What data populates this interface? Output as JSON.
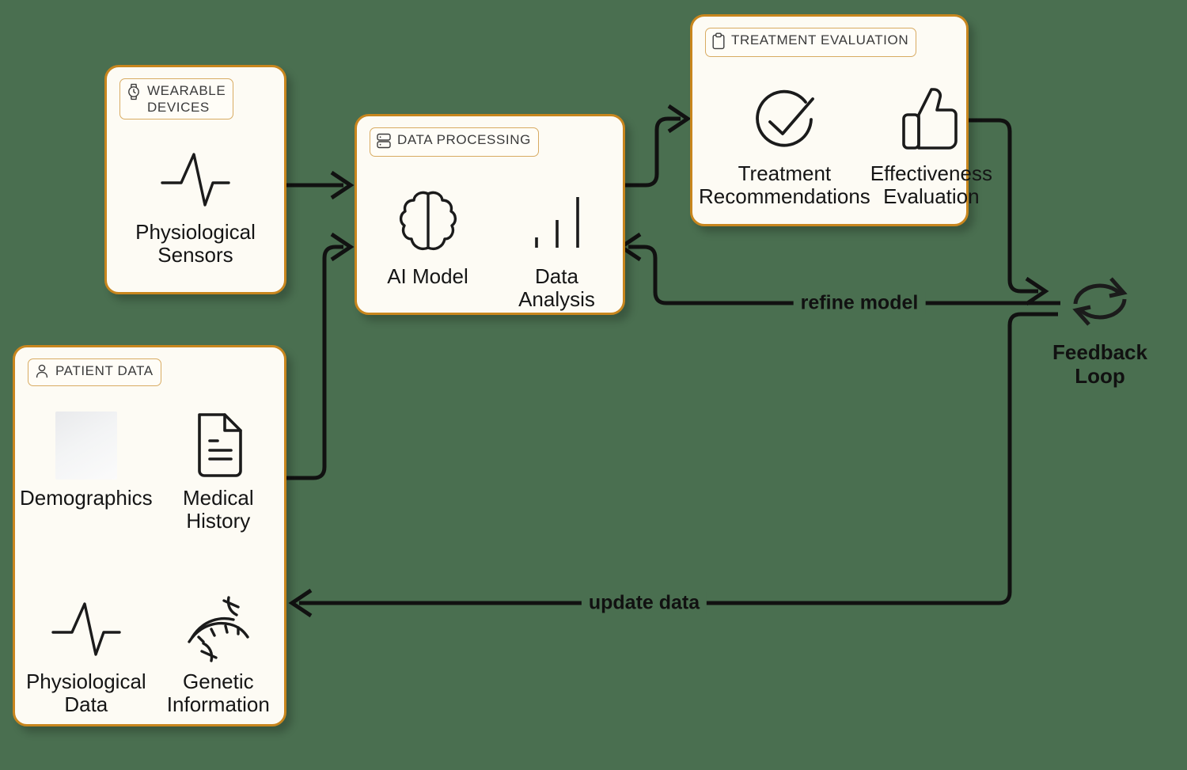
{
  "theme": {
    "background": "#4a6f50",
    "node_fill": "#fdfbf4",
    "node_border": "#c8861e",
    "badge_border": "#d8ab62",
    "stroke": "#111111"
  },
  "nodes": [
    {
      "id": "wearable-devices",
      "badge_label": "WEARABLE\nDEVICES",
      "badge_icon": "watch-icon",
      "items": [
        {
          "label": "Physiological\nSensors",
          "icon": "pulse-wave-icon"
        }
      ]
    },
    {
      "id": "patient-data",
      "badge_label": "PATIENT DATA",
      "badge_icon": "person-icon",
      "items": [
        {
          "label": "Demographics",
          "icon": "image-placeholder-icon"
        },
        {
          "label": "Medical\nHistory",
          "icon": "document-icon"
        },
        {
          "label": "Physiological\nData",
          "icon": "pulse-wave-icon"
        },
        {
          "label": "Genetic\nInformation",
          "icon": "dna-icon"
        }
      ]
    },
    {
      "id": "data-processing",
      "badge_label": "DATA PROCESSING",
      "badge_icon": "server-icon",
      "items": [
        {
          "label": "AI Model",
          "icon": "brain-icon"
        },
        {
          "label": "Data\nAnalysis",
          "icon": "bar-chart-icon"
        }
      ]
    },
    {
      "id": "treatment-evaluation",
      "badge_label": "TREATMENT EVALUATION",
      "badge_icon": "clipboard-icon",
      "items": [
        {
          "label": "Treatment\nRecommendations",
          "icon": "check-circle-icon"
        },
        {
          "label": "Effectiveness\nEvaluation",
          "icon": "thumbs-up-icon"
        }
      ]
    }
  ],
  "loop_node": {
    "id": "feedback-loop",
    "label": "Feedback\nLoop",
    "icon": "refresh-cycle-icon"
  },
  "edges": [
    {
      "id": "wearable-to-processing",
      "label": "",
      "from": "wearable-devices",
      "to": "data-processing"
    },
    {
      "id": "patient-to-processing",
      "label": "",
      "from": "patient-data",
      "to": "data-processing"
    },
    {
      "id": "processing-to-treatment",
      "label": "",
      "from": "data-processing",
      "to": "treatment-evaluation"
    },
    {
      "id": "treatment-to-loop",
      "label": "",
      "from": "treatment-evaluation",
      "to": "feedback-loop"
    },
    {
      "id": "loop-refine-model",
      "label": "refine model",
      "from": "feedback-loop",
      "to": "data-processing"
    },
    {
      "id": "loop-update-data",
      "label": "update data",
      "from": "feedback-loop",
      "to": "patient-data"
    }
  ]
}
